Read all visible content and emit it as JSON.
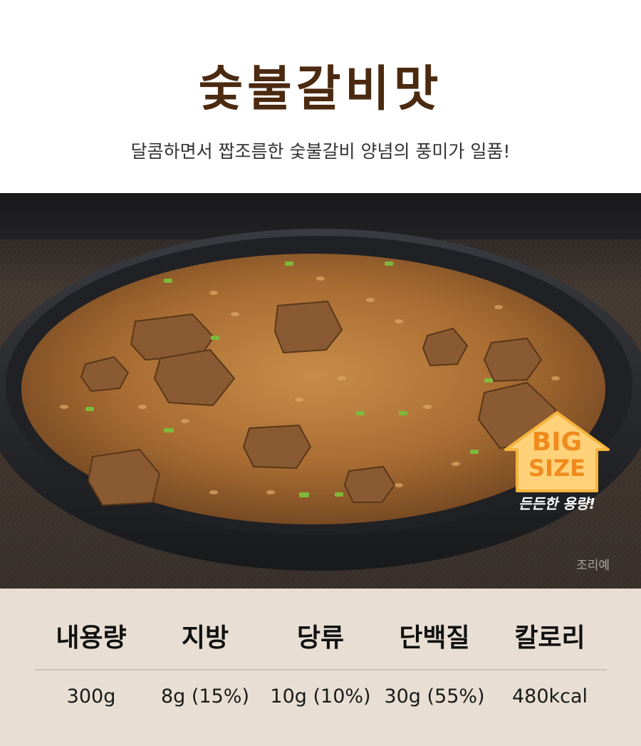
{
  "header": {
    "title": "숯불갈비맛",
    "subtitle": "달콤하면서 짭조름한 숯불갈비 양념의 풍미가 일품!"
  },
  "photo": {
    "badge_line1": "BIG",
    "badge_line2": "SIZE",
    "badge_tag": "든든한 용량!",
    "caption": "조리예",
    "colors": {
      "badge_fill": "#ffd27a",
      "badge_text": "#f08a1c",
      "bowl": "#2a2b2f",
      "rice": "#b27a3e"
    }
  },
  "nutrition": {
    "headers": [
      "내용량",
      "지방",
      "당류",
      "단백질",
      "칼로리"
    ],
    "values": [
      "300g",
      "8g (15%)",
      "10g (10%)",
      "30g (55%)",
      "480kcal"
    ]
  }
}
